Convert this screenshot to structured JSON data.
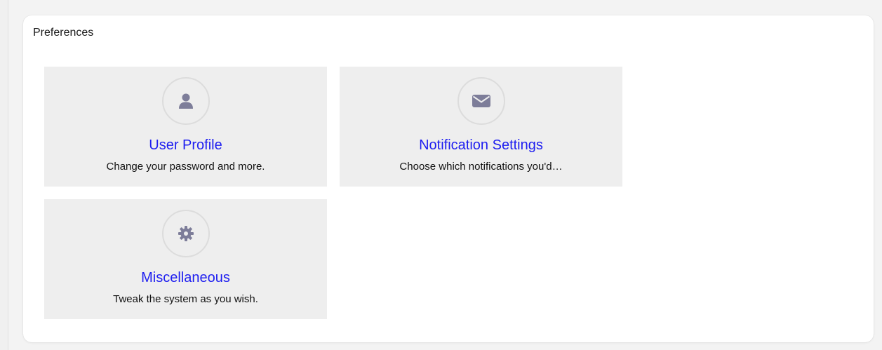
{
  "panel": {
    "title": "Preferences"
  },
  "tiles": [
    {
      "title": "User Profile",
      "description": "Change your password and more.",
      "icon": "user-icon"
    },
    {
      "title": "Notification Settings",
      "description": "Choose which notifications you'd…",
      "icon": "envelope-icon"
    },
    {
      "title": "Miscellaneous",
      "description": "Tweak the system as you wish.",
      "icon": "gear-icon"
    }
  ],
  "colors": {
    "link": "#1e1ef0",
    "tile_background": "#eeeeee",
    "icon": "#7d7d99"
  }
}
